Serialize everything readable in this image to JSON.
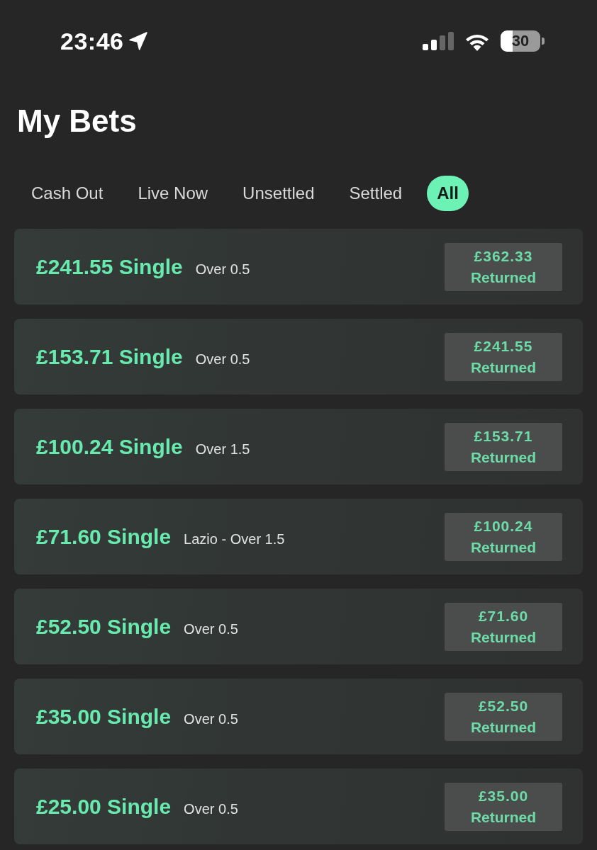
{
  "status_bar": {
    "time": "23:46",
    "battery": "30"
  },
  "title": "My Bets",
  "tabs": [
    {
      "label": "Cash Out",
      "selected": false
    },
    {
      "label": "Live Now",
      "selected": false
    },
    {
      "label": "Unsettled",
      "selected": false
    },
    {
      "label": "Settled",
      "selected": false
    },
    {
      "label": "All",
      "selected": true
    }
  ],
  "bets": [
    {
      "stake": "£241.55 Single",
      "selection": "Over 0.5",
      "return_amount": "£362.33",
      "return_status": "Returned"
    },
    {
      "stake": "£153.71 Single",
      "selection": "Over 0.5",
      "return_amount": "£241.55",
      "return_status": "Returned"
    },
    {
      "stake": "£100.24 Single",
      "selection": "Over 1.5",
      "return_amount": "£153.71",
      "return_status": "Returned"
    },
    {
      "stake": "£71.60 Single",
      "selection": "Lazio - Over 1.5",
      "return_amount": "£100.24",
      "return_status": "Returned"
    },
    {
      "stake": "£52.50 Single",
      "selection": "Over 0.5",
      "return_amount": "£71.60",
      "return_status": "Returned"
    },
    {
      "stake": "£35.00 Single",
      "selection": "Over 0.5",
      "return_amount": "£52.50",
      "return_status": "Returned"
    },
    {
      "stake": "£25.00 Single",
      "selection": "Over 0.5",
      "return_amount": "£35.00",
      "return_status": "Returned"
    }
  ]
}
